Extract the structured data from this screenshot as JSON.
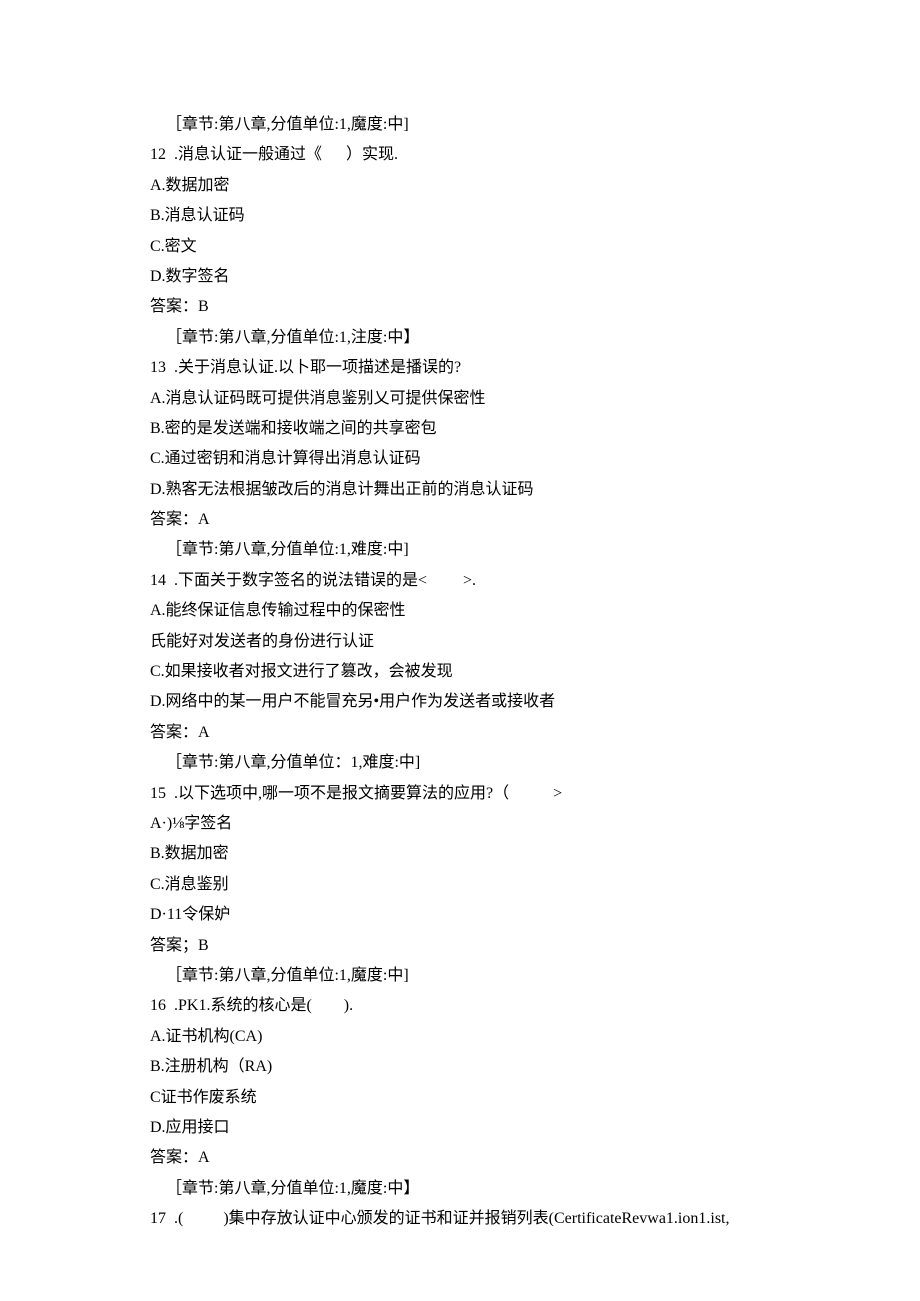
{
  "lines": [
    {
      "text": "［章节:第八章,分值单位:1,魔度:中]",
      "indent": true
    },
    {
      "text": "12  .消息认证一般通过《      ）实现."
    },
    {
      "text": "A.数据加密"
    },
    {
      "text": "B.消息认证码"
    },
    {
      "text": "C.密文"
    },
    {
      "text": "D.数字签名"
    },
    {
      "text": "答案：B"
    },
    {
      "text": "［章节:第八章,分值单位:1,注度:中】",
      "indent": true
    },
    {
      "text": "13  .关于消息认证.以卜耶一项描述是播误的?"
    },
    {
      "text": "A.消息认证码既可提供消息鉴别乂可提供保密性"
    },
    {
      "text": "B.密的是发送端和接收端之间的共享密包"
    },
    {
      "text": "C.通过密钥和消息计算得出消息认证码"
    },
    {
      "text": "D.熟客无法根据皱改后的消息计舞出正前的消息认证码"
    },
    {
      "text": "答案：A"
    },
    {
      "text": "［章节:第八章,分值单位:1,难度:中]",
      "indent": true
    },
    {
      "text": "14  .下面关于数字签名的说法错误的是<         >."
    },
    {
      "text": "A.能终保证信息传输过程中的保密性"
    },
    {
      "text": "氏能好对发送者的身份进行认证"
    },
    {
      "text": "C.如果接收者对报文进行了篡改，会被发现"
    },
    {
      "text": "D.网络中的某一用户不能冒充另•用户作为发送者或接收者"
    },
    {
      "text": "答案：A"
    },
    {
      "text": "［章节:第八章,分值单位：1,难度:中]",
      "indent": true
    },
    {
      "text": "15  .以下选项中,哪一项不是报文摘要算法的应用?（           >"
    },
    {
      "text": "A·)⅛字签名"
    },
    {
      "text": "B.数据加密"
    },
    {
      "text": "C.消息鉴别"
    },
    {
      "text": "D·11令保妒"
    },
    {
      "text": "答案；B"
    },
    {
      "text": "［章节:第八章,分值单位:1,魔度:中]",
      "indent": true
    },
    {
      "text": "16  .PK1.系统的核心是(        )."
    },
    {
      "text": "A.证书机构(CA)"
    },
    {
      "text": "B.注册机构（RA)"
    },
    {
      "text": "C证书作废系统"
    },
    {
      "text": "D.应用接口"
    },
    {
      "text": "答案：A"
    },
    {
      "text": "［章节:第八章,分值单位:1,魔度:中】",
      "indent": true
    },
    {
      "text": "17  .(          )集中存放认证中心颁发的证书和证并报销列表(CertificateRevwa1.ion1.ist,"
    }
  ]
}
